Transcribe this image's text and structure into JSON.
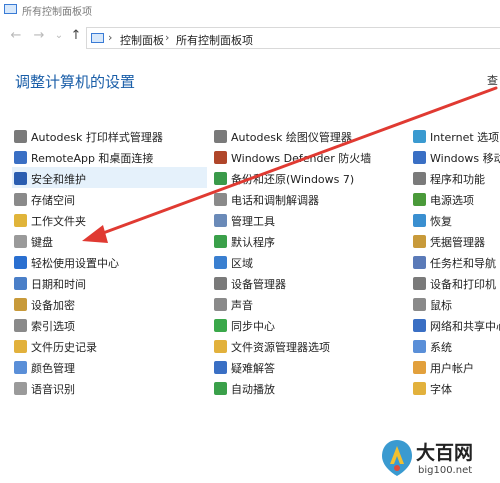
{
  "window": {
    "title": "所有控制面板项"
  },
  "nav": {
    "back": "←",
    "forward": "→",
    "recent": "⌄",
    "up": "↑"
  },
  "breadcrumb": {
    "sep1": "›",
    "item1": "控制面板",
    "sep2": "›",
    "item2": "所有控制面板项"
  },
  "page": {
    "title": "调整计算机的设置",
    "view_label": "查"
  },
  "columns": [
    [
      {
        "label": "Autodesk 打印样式管理器",
        "icon": "printer-style-icon",
        "color": "#7a7a7a"
      },
      {
        "label": "RemoteApp 和桌面连接",
        "icon": "remote-desktop-icon",
        "color": "#3a6fc4"
      },
      {
        "label": "安全和维护",
        "icon": "security-flag-icon",
        "color": "#2a5db0"
      },
      {
        "label": "存储空间",
        "icon": "storage-icon",
        "color": "#8a8a8a"
      },
      {
        "label": "工作文件夹",
        "icon": "work-folder-icon",
        "color": "#e0b43a"
      },
      {
        "label": "键盘",
        "icon": "keyboard-icon",
        "color": "#9a9a9a"
      },
      {
        "label": "轻松使用设置中心",
        "icon": "ease-of-access-icon",
        "color": "#2a6fd0"
      },
      {
        "label": "日期和时间",
        "icon": "date-time-icon",
        "color": "#4a7fc8"
      },
      {
        "label": "设备加密",
        "icon": "device-encryption-icon",
        "color": "#c89a3a"
      },
      {
        "label": "索引选项",
        "icon": "indexing-icon",
        "color": "#8a8a8a"
      },
      {
        "label": "文件历史记录",
        "icon": "file-history-icon",
        "color": "#e2b13c"
      },
      {
        "label": "颜色管理",
        "icon": "color-management-icon",
        "color": "#5a8fd8"
      },
      {
        "label": "语音识别",
        "icon": "speech-icon",
        "color": "#9a9a9a"
      }
    ],
    [
      {
        "label": "Autodesk 绘图仪管理器",
        "icon": "plotter-icon",
        "color": "#7a7a7a"
      },
      {
        "label": "Windows Defender 防火墙",
        "icon": "firewall-icon",
        "color": "#b0462a"
      },
      {
        "label": "备份和还原(Windows 7)",
        "icon": "backup-icon",
        "color": "#3a9a4a"
      },
      {
        "label": "电话和调制解调器",
        "icon": "phone-modem-icon",
        "color": "#8a8a8a"
      },
      {
        "label": "管理工具",
        "icon": "admin-tools-icon",
        "color": "#6a8ab8"
      },
      {
        "label": "默认程序",
        "icon": "default-programs-icon",
        "color": "#3aa04a"
      },
      {
        "label": "区域",
        "icon": "region-icon",
        "color": "#3a7fd0"
      },
      {
        "label": "设备管理器",
        "icon": "device-manager-icon",
        "color": "#7a7a7a"
      },
      {
        "label": "声音",
        "icon": "sound-icon",
        "color": "#8a8a8a"
      },
      {
        "label": "同步中心",
        "icon": "sync-center-icon",
        "color": "#3aa84a"
      },
      {
        "label": "文件资源管理器选项",
        "icon": "explorer-options-icon",
        "color": "#e2b13c"
      },
      {
        "label": "疑难解答",
        "icon": "troubleshooting-icon",
        "color": "#3a6fc4"
      },
      {
        "label": "自动播放",
        "icon": "autoplay-icon",
        "color": "#3aa04a"
      }
    ],
    [
      {
        "label": "Internet 选项",
        "icon": "internet-options-icon",
        "color": "#3a9ad0"
      },
      {
        "label": "Windows 移动中心",
        "icon": "mobility-center-icon",
        "color": "#3a6fc4"
      },
      {
        "label": "程序和功能",
        "icon": "programs-icon",
        "color": "#7a7a7a"
      },
      {
        "label": "电源选项",
        "icon": "power-icon",
        "color": "#4a9a3a"
      },
      {
        "label": "恢复",
        "icon": "recovery-icon",
        "color": "#3a8fd0"
      },
      {
        "label": "凭据管理器",
        "icon": "credential-icon",
        "color": "#c89a3a"
      },
      {
        "label": "任务栏和导航",
        "icon": "taskbar-icon",
        "color": "#5a7ab8"
      },
      {
        "label": "设备和打印机",
        "icon": "printer-icon",
        "color": "#7a7a7a"
      },
      {
        "label": "鼠标",
        "icon": "mouse-icon",
        "color": "#8a8a8a"
      },
      {
        "label": "网络和共享中心",
        "icon": "network-icon",
        "color": "#3a6fc4"
      },
      {
        "label": "系统",
        "icon": "system-icon",
        "color": "#5a8fd8"
      },
      {
        "label": "用户帐户",
        "icon": "user-accounts-icon",
        "color": "#e2a03c"
      },
      {
        "label": "字体",
        "icon": "fonts-icon",
        "color": "#e2b13c"
      }
    ]
  ],
  "annotation": {
    "arrow_color": "#e03a32"
  },
  "watermark": {
    "title": "大百网",
    "url": "big100.net"
  }
}
